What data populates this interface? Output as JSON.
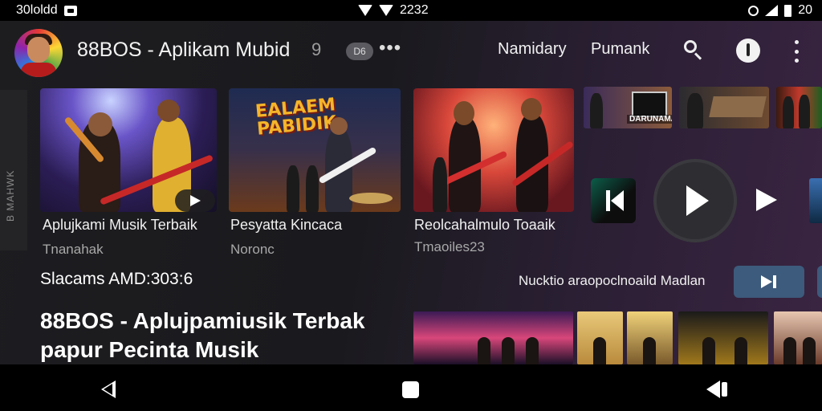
{
  "status_bar": {
    "left_text": "30loldd",
    "center_text": "2232",
    "right_text": "20"
  },
  "header": {
    "app_title": "88BOS - Aplikam Mubid",
    "icon_label": "9",
    "badge": "D6",
    "more": "•••",
    "nav": [
      "Namidary",
      "Pumank"
    ]
  },
  "side": {
    "label": "B MAHWK"
  },
  "cards": [
    {
      "title": "Aplujkami Musik Terbaik",
      "subtitle": "Tnanahak"
    },
    {
      "title": "Pesyatta Kincaca",
      "subtitle": "Noronc"
    },
    {
      "title": "Reolcahalmulo Toaaik",
      "subtitle": "Tmaoiles23"
    }
  ],
  "poster_text": "EALAEM PABIDIK",
  "mini_thumbs": [
    {
      "label": "DARUNAMAN"
    },
    {
      "label": ""
    },
    {
      "label": ""
    }
  ],
  "status_line": "Slacams AMD:303:6",
  "now_playing": "Nucktio araopoclnoaild Madlan",
  "heading": {
    "line1": "88BOS - Aplujpamiusik Terbak",
    "line2": "papur Pecinta Musik"
  },
  "colors": {
    "background": "#141416",
    "accent_button": "#3d5b7c",
    "poster_text": "#f5b52a"
  }
}
